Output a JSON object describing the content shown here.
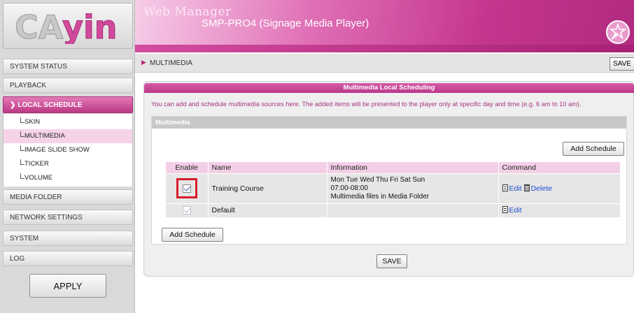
{
  "logo": {
    "text": "CAYIN"
  },
  "header": {
    "title": "Web Manager",
    "product": "SMP-PRO4 (Signage Media Player)",
    "accent_color": "#c4358e",
    "badge_icon": "wand-star-icon"
  },
  "sidebar": {
    "items": [
      {
        "label": "SYSTEM STATUS"
      },
      {
        "label": "PLAYBACK"
      },
      {
        "label": "LOCAL SCHEDULE",
        "active": true
      },
      {
        "label": "MEDIA FOLDER"
      },
      {
        "label": "NETWORK SETTINGS"
      },
      {
        "label": "SYSTEM"
      },
      {
        "label": "LOG"
      }
    ],
    "subitems": [
      {
        "label": "SKIN"
      },
      {
        "label": "MULTIMEDIA",
        "active": true
      },
      {
        "label": "IMAGE SLIDE SHOW"
      },
      {
        "label": "TICKER"
      },
      {
        "label": "VOLUME"
      }
    ],
    "apply_label": "APPLY"
  },
  "breadcrumb": {
    "text": "MULTIMEDIA",
    "save_label": "SAVE"
  },
  "panel": {
    "title": "Multimedia Local Scheduling",
    "description": "You can add and schedule multimedia sources here. The added items will be presented to the player only at specific day and time (e.g. 6 am to 10 am).",
    "section_title": "Multimedia",
    "add_schedule_label": "Add Schedule",
    "save_label": "SAVE"
  },
  "table": {
    "headers": [
      "Enable",
      "Name",
      "Information",
      "Command"
    ],
    "rows": [
      {
        "enabled": true,
        "name": "Training Course",
        "info": [
          "Mon Tue Wed Thu Fri Sat Sun",
          "07:00-08:00",
          "Multimedia files in Media Folder"
        ],
        "edit_label": "Edit",
        "delete_label": "Delete"
      },
      {
        "enabled": true,
        "name": "Default",
        "info": [],
        "edit_label": "Edit"
      }
    ]
  }
}
